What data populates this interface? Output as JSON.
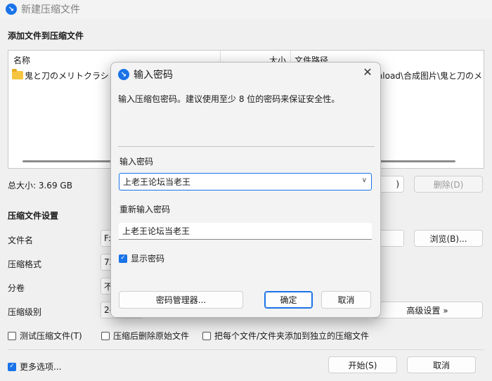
{
  "window": {
    "title": "新建压缩文件"
  },
  "add_section": {
    "title": "添加文件到压缩文件"
  },
  "file_list": {
    "columns": [
      "名称",
      "大小",
      "文件路径"
    ],
    "rows": [
      {
        "name": "鬼と刀のメリトクラシ",
        "path": "nload\\合成图片\\鬼と刀のメ"
      }
    ]
  },
  "summary": {
    "total_size": "总大小: 3.69 GB"
  },
  "list_buttons": {
    "add_partial": ")",
    "delete": "删除(D)"
  },
  "settings": {
    "title": "压缩文件设置",
    "filename_label": "文件名",
    "filename_value": "F:",
    "browse": "浏览(B)...",
    "format_label": "压缩格式",
    "format_value": "7Z",
    "volume_label": "分卷",
    "volume_value": "不",
    "level_label": "压缩级别",
    "level_value": "2-",
    "advanced": "高级设置 »"
  },
  "options": {
    "test": "测试压缩文件(T)",
    "delete_source": "压缩后删除原始文件",
    "separate": "把每个文件/文件夹添加到独立的压缩文件",
    "more": "更多选项..."
  },
  "footer": {
    "start": "开始(S)",
    "cancel": "取消"
  },
  "dialog": {
    "title": "输入密码",
    "description": "输入压缩包密码。建议使用至少 8 位的密码来保证安全性。",
    "password_label": "输入密码",
    "password_value": "上老王论坛当老王",
    "confirm_label": "重新输入密码",
    "confirm_value": "上老王论坛当老王",
    "show_password": "显示密码",
    "manager": "密码管理器...",
    "ok": "确定",
    "cancel": "取消"
  },
  "colors": {
    "accent": "#1a73e8"
  },
  "icons": [
    "app-logo-icon",
    "folder-icon",
    "close-icon",
    "chevron-down-icon",
    "checkbox-checked-icon"
  ]
}
